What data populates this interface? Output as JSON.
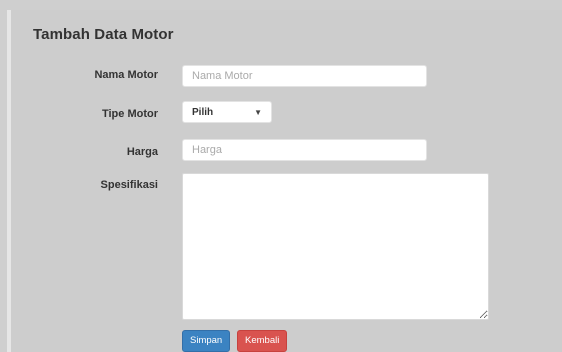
{
  "form": {
    "title": "Tambah Data Motor",
    "fields": {
      "nama_motor": {
        "label": "Nama Motor",
        "placeholder": "Nama Motor",
        "value": ""
      },
      "tipe_motor": {
        "label": "Tipe Motor",
        "selected": "Pilih"
      },
      "harga": {
        "label": "Harga",
        "placeholder": "Harga",
        "value": ""
      },
      "spesifikasi": {
        "label": "Spesifikasi",
        "value": ""
      }
    },
    "buttons": {
      "save_label": "Simpan",
      "back_label": "Kembali"
    }
  },
  "icons": {
    "select_caret": "caret-down-icon"
  },
  "colors": {
    "background": "#cdcdcd",
    "primary": "#3b83c2",
    "danger": "#d9534f",
    "input_bg": "#ffffff"
  }
}
